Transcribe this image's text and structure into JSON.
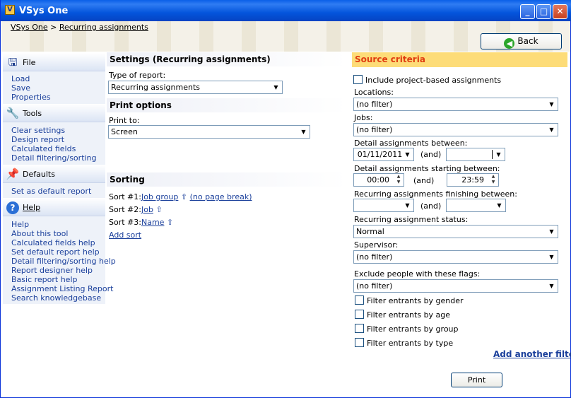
{
  "window": {
    "title": "VSys One"
  },
  "breadcrumb": {
    "root": "VSys One",
    "sep": ">",
    "current": "Recurring assignments"
  },
  "back_button": "Back",
  "sidebar": {
    "file": {
      "title": "File",
      "items": [
        "Load",
        "Save",
        "Properties"
      ]
    },
    "tools": {
      "title": "Tools",
      "items": [
        "Clear settings",
        "Design report",
        "Calculated fields",
        "Detail filtering/sorting"
      ]
    },
    "defaults": {
      "title": "Defaults",
      "items": [
        "Set as default report"
      ]
    },
    "help": {
      "title": "Help",
      "items": [
        "Help",
        "About this tool",
        "Calculated fields help",
        "Set default report help",
        "Detail filtering/sorting help",
        "Report designer help",
        "Basic report help",
        "Assignment Listing Report",
        "Search knowledgebase"
      ]
    }
  },
  "settings": {
    "title": "Settings (Recurring assignments)",
    "type_label": "Type of report:",
    "type_value": "Recurring assignments",
    "print_title": "Print options",
    "print_to_label": "Print to:",
    "print_to_value": "Screen"
  },
  "sorting": {
    "title": "Sorting",
    "sorts": [
      {
        "label": "Sort #1:",
        "field": "Job group",
        "arrow": "⇧",
        "extra": "(no page break)"
      },
      {
        "label": "Sort #2:",
        "field": "Job",
        "arrow": "⇧"
      },
      {
        "label": "Sort #3:",
        "field": "Name",
        "arrow": "⇧"
      }
    ],
    "add_sort": "Add sort"
  },
  "criteria": {
    "title": "Source criteria",
    "include_project": "Include project-based assignments",
    "locations_label": "Locations:",
    "locations_value": "(no filter)",
    "jobs_label": "Jobs:",
    "jobs_value": "(no filter)",
    "detail_between_label": "Detail assignments between:",
    "detail_from": "01/11/2011",
    "and": "(and)",
    "detail_starting_label": "Detail assignments starting between:",
    "start_from": "00:00",
    "start_to": "23:59",
    "finishing_label": "Recurring assignments finishing between:",
    "status_label": "Recurring assignment status:",
    "status_value": "Normal",
    "supervisor_label": "Supervisor:",
    "supervisor_value": "(no filter)",
    "flags_label": "Exclude people with these flags:",
    "flags_value": "(no filter)",
    "filters": [
      "Filter entrants by gender",
      "Filter entrants by age",
      "Filter entrants by group",
      "Filter entrants by type"
    ],
    "add_filter": "Add another filter"
  },
  "print_button": "Print"
}
